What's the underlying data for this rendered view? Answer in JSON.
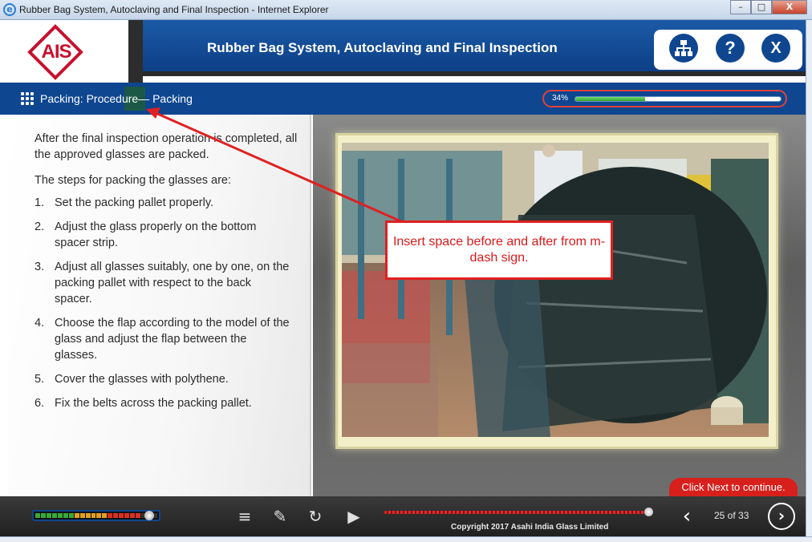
{
  "browser": {
    "window_title": "Rubber Bag System, Autoclaving and Final Inspection - Internet Explorer",
    "ie_icon_glyph": "e",
    "minimize_glyph": "–",
    "maximize_glyph": "□",
    "close_glyph": "X"
  },
  "header": {
    "logo_text": "AIS",
    "course_title": "Rubber Bag System, Autoclaving and Final Inspection",
    "help_glyph": "?",
    "exit_glyph": "X",
    "brand_color": "#0e4690",
    "logo_color": "#c8102e"
  },
  "subnav": {
    "breadcrumb": "Packing: Procedure— Packing",
    "progress_label": "34%",
    "progress_value": 0.34
  },
  "content": {
    "intro": "After the final inspection operation is completed, all the approved glasses are packed.",
    "steps_heading": "The steps for packing the glasses are:",
    "steps": [
      {
        "num": "1.",
        "text": "Set the packing pallet properly."
      },
      {
        "num": "2.",
        "text": "Adjust the glass properly on the bottom spacer strip."
      },
      {
        "num": "3.",
        "text": "Adjust all glasses suitably, one by one, on the packing pallet with respect to the back spacer."
      },
      {
        "num": "4.",
        "text": "Choose the flap according to the model of the glass and adjust the flap between the glasses."
      },
      {
        "num": "5.",
        "text": "Cover the glasses with polythene."
      },
      {
        "num": "6.",
        "text": "Fix the belts across the packing pallet."
      }
    ]
  },
  "annotation": {
    "text": "Insert space before and after from m-dash sign.",
    "color": "#e02020"
  },
  "next_hint": "Click Next to continue.",
  "footer": {
    "copyright": "Copyright 2017 Asahi India Glass Limited",
    "page_counter": "25 of 33",
    "prev_glyph": "‹",
    "next_glyph": "›",
    "play_glyph": "▶",
    "replay_glyph": "↻",
    "notes_glyph": "✎",
    "transcript_glyph": "≡",
    "volume_level": 0.88,
    "seek_position": 0.995
  }
}
